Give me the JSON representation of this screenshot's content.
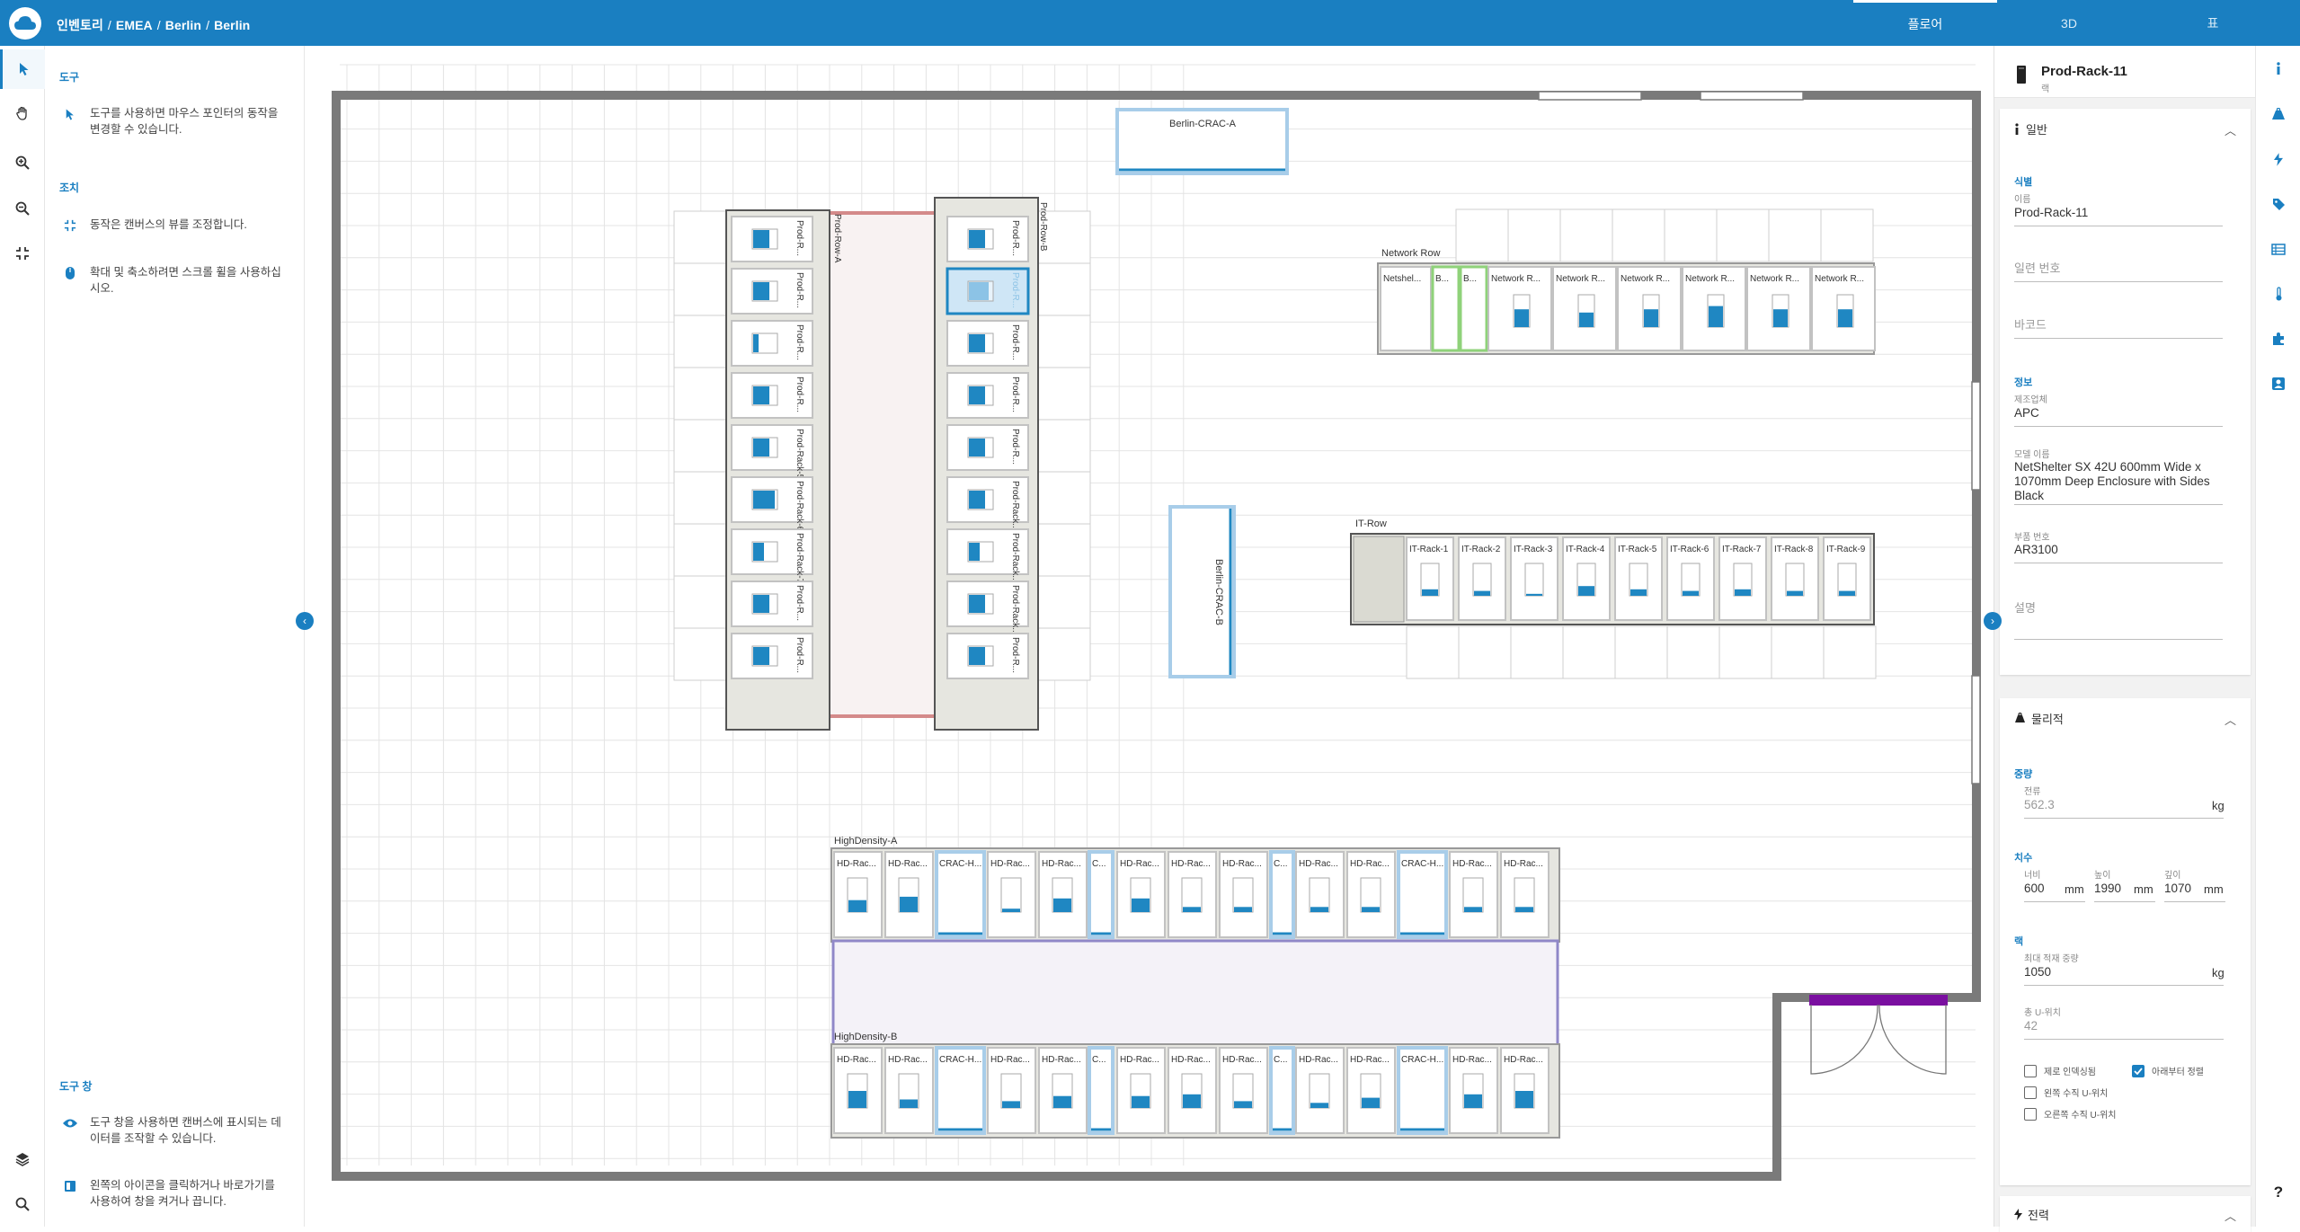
{
  "header": {
    "breadcrumb": [
      "인벤토리",
      "EMEA",
      "Berlin",
      "Berlin"
    ],
    "tabs": [
      {
        "label": "플로어",
        "active": true
      },
      {
        "label": "3D",
        "active": false
      },
      {
        "label": "표",
        "active": false
      }
    ],
    "accent_color": "#1a7fc1"
  },
  "toolbar": {
    "tools": [
      "pointer-icon",
      "hand-icon",
      "zoom-in-icon",
      "zoom-out-icon",
      "fit-icon"
    ],
    "bottom": [
      "layers-icon",
      "search-icon"
    ]
  },
  "help": {
    "tools_title": "도구",
    "tools_text": "도구를 사용하면 마우스 포인터의 동작을 변경할 수 있습니다.",
    "actions_title": "조치",
    "actions_text1": "동작은 캔버스의 뷰를 조정합니다.",
    "actions_text2": "확대 및 축소하려면 스크롤 휠을 사용하십시오.",
    "toolpane_title": "도구 창",
    "toolpane_text1": "도구 창을 사용하면 캔버스에 표시되는 데이터를 조작할 수 있습니다.",
    "toolpane_text2": "왼쪽의 아이콘을 클릭하거나 바로가기를 사용하여 창을 켜거나 끕니다."
  },
  "floor": {
    "crac_a": "Berlin-CRAC-A",
    "crac_b": "Berlin-CRAC-B",
    "prod_row_a": "Prod-Row-A",
    "prod_row_b": "Prod-Row-B",
    "prod_a_labels": [
      "Prod-R...",
      "Prod-R...",
      "Prod-R...",
      "Prod-R...",
      "Prod-Rack-5",
      "Prod-Rack-6",
      "Prod-Rack-7",
      "Prod-R...",
      "Prod-R..."
    ],
    "prod_a_fill": [
      0.45,
      0.45,
      0.15,
      0.45,
      0.45,
      0.6,
      0.3,
      0.45,
      0.45
    ],
    "prod_b_labels": [
      "Prod-R...",
      "Prod-R...",
      "Prod-R...",
      "Prod-R...",
      "Prod-R...",
      "Prod-Rack...",
      "Prod-Rack...",
      "Prod-Rack...",
      "Prod-R..."
    ],
    "prod_b_fill": [
      0.45,
      0.55,
      0.45,
      0.45,
      0.45,
      0.45,
      0.3,
      0.45,
      0.45
    ],
    "network_row": "Network Row",
    "network_labels": [
      "Netshel...",
      "B...",
      "B...",
      "Network R...",
      "Network R...",
      "Network R...",
      "Network R...",
      "Network R...",
      "Network R..."
    ],
    "network_fill": [
      0,
      0,
      0,
      0.55,
      0.45,
      0.55,
      0.65,
      0.55,
      0.55
    ],
    "it_row": "IT-Row",
    "it_labels": [
      "IT-Rack-1",
      "IT-Rack-2",
      "IT-Rack-3",
      "IT-Rack-4",
      "IT-Rack-5",
      "IT-Rack-6",
      "IT-Rack-7",
      "IT-Rack-8",
      "IT-Rack-9"
    ],
    "it_fill": [
      0.2,
      0.15,
      0.05,
      0.3,
      0.2,
      0.15,
      0.2,
      0.15,
      0.15
    ],
    "hd_a": "HighDensity-A",
    "hd_b": "HighDensity-B",
    "hd_a_labels": [
      "HD-Rac...",
      "HD-Rac...",
      "CRAC-H...",
      "HD-Rac...",
      "HD-Rac...",
      "C...",
      "HD-Rac...",
      "HD-Rac...",
      "HD-Rac...",
      "C...",
      "HD-Rac...",
      "HD-Rac...",
      "CRAC-H...",
      "HD-Rac...",
      "HD-Rac..."
    ],
    "hd_a_fill": [
      0.35,
      0.45,
      -1,
      0.1,
      0.4,
      -1,
      0.4,
      0.15,
      0.15,
      -1,
      0.15,
      0.15,
      -1,
      0.15,
      0.15
    ],
    "hd_b_labels": [
      "HD-Rac...",
      "HD-Rac...",
      "CRAC-H...",
      "HD-Rac...",
      "HD-Rac...",
      "C...",
      "HD-Rac...",
      "HD-Rac...",
      "HD-Rac...",
      "C...",
      "HD-Rac...",
      "HD-Rac...",
      "CRAC-H...",
      "HD-Rac...",
      "HD-Rac..."
    ],
    "hd_b_fill": [
      0.5,
      0.25,
      -1,
      0.2,
      0.35,
      -1,
      0.35,
      0.4,
      0.2,
      -1,
      0.15,
      0.3,
      -1,
      0.4,
      0.5
    ]
  },
  "panel": {
    "title": "Prod-Rack-11",
    "subtitle": "랙",
    "general": "일반",
    "identification": "식별",
    "name_label": "이름",
    "name_value": "Prod-Rack-11",
    "serial_ph": "일련 번호",
    "barcode_ph": "바코드",
    "info": "정보",
    "mfr_label": "제조업체",
    "mfr_value": "APC",
    "model_label": "모델 이름",
    "model_value": "NetShelter SX 42U 600mm Wide x 1070mm Deep Enclosure with Sides Black",
    "part_label": "부품 번호",
    "part_value": "AR3100",
    "desc_ph": "설명",
    "physical": "물리적",
    "weight": "중량",
    "empty_label": "전류",
    "empty_value": "562.3",
    "kg": "kg",
    "dims": "치수",
    "w_label": "너비",
    "w_value": "600",
    "h_label": "높이",
    "h_value": "1990",
    "d_label": "깊이",
    "d_value": "1070",
    "mm": "mm",
    "rack": "랙",
    "max_label": "최대 적재 중량",
    "max_value": "1050",
    "u_label": "총 U-위치",
    "u_value": "42",
    "chk1": "제로 인덱싱됨",
    "chk2": "아래부터 정렬",
    "chk3": "왼쪽 수직 U-위치",
    "chk4": "오른쪽 수직 U-위치",
    "power": "전력"
  },
  "iconbar": [
    "info-icon",
    "rack-icon",
    "power-icon",
    "tag-icon",
    "table-icon",
    "thermometer-icon",
    "plugin-icon",
    "user-icon",
    "help-icon"
  ]
}
